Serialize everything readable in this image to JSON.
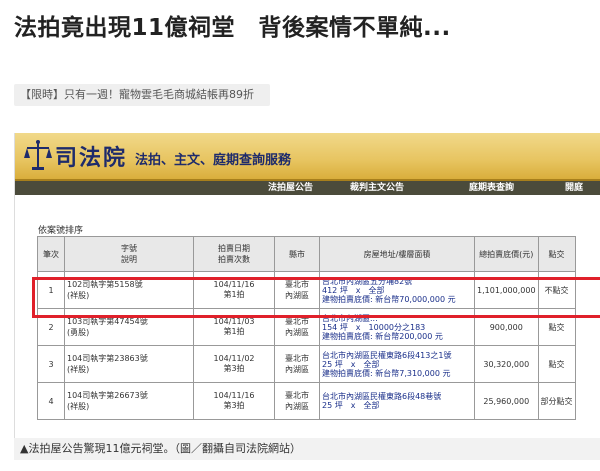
{
  "article": {
    "headline": "法拍竟出現11億祠堂　背後案情不單純...",
    "promo": "【限時】只有一週！寵物雲毛毛商城結帳再89折",
    "caption": "▲法拍屋公告驚現11億元祠堂。（圖／翻攝自司法院網站）"
  },
  "site": {
    "logo_text": "司法院",
    "logo_sub": "法拍、主文、庭期查詢服務",
    "nav": [
      "法拍屋公告",
      "裁判主文公告",
      "庭期表查詢",
      "開庭"
    ],
    "sort_label": "依案號排序"
  },
  "table": {
    "headers": [
      "筆次",
      "字號\n說明",
      "拍賣日期\n拍賣次數",
      "縣市",
      "房屋地址/樓層面積",
      "總拍賣底價(元)",
      "點交"
    ],
    "rows": [
      {
        "idx": "1",
        "case": "102司執字第5158號",
        "desc": "(祥股)",
        "date": "104/11/16",
        "round": "第1拍",
        "city": "臺北市",
        "district": "內湖區",
        "addr": "台北市內湖區五分埔82號",
        "area": "412 坪　x　全部",
        "price_text": "建物拍賣底價: 新台幣70,000,000 元",
        "total": "1,101,000,000",
        "deliver": "不點交"
      },
      {
        "idx": "2",
        "case": "103司執字第47454號",
        "desc": "(勇股)",
        "date": "104/11/03",
        "round": "第1拍",
        "city": "臺北市",
        "district": "內湖區",
        "addr": "台北市內湖區...",
        "area": "154 坪　x　10000分之183",
        "price_text": "建物拍賣底價: 新台幣200,000 元",
        "total": "900,000",
        "deliver": "點交"
      },
      {
        "idx": "3",
        "case": "104司執字第23863號",
        "desc": "(祥股)",
        "date": "104/11/02",
        "round": "第3拍",
        "city": "臺北市",
        "district": "內湖區",
        "addr": "台北市內湖區民權東路6段413之1號",
        "area": "25 坪　x　全部",
        "price_text": "建物拍賣底價: 新台幣7,310,000 元",
        "total": "30,320,000",
        "deliver": "點交"
      },
      {
        "idx": "4",
        "case": "104司執字第26673號",
        "desc": "(祥股)",
        "date": "104/11/16",
        "round": "第3拍",
        "city": "臺北市",
        "district": "內湖區",
        "addr": "台北市內湖區民權東路6段48巷號",
        "area": "25 坪　x　全部",
        "price_text": "",
        "total": "25,960,000",
        "deliver": "部分點交"
      }
    ]
  }
}
